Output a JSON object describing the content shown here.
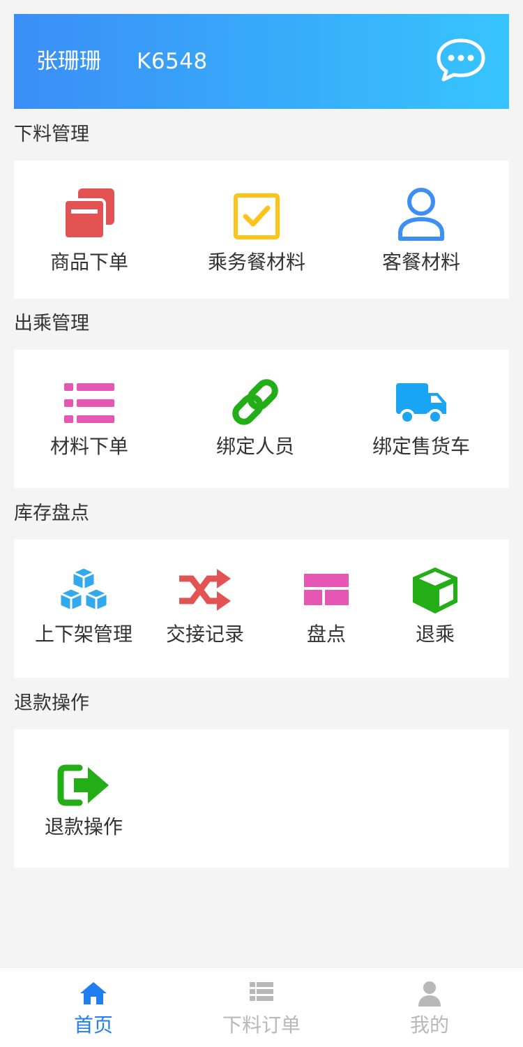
{
  "header": {
    "user_name": "张珊珊",
    "train_code": "K6548",
    "message_icon": "chat-bubble-icon"
  },
  "sections": [
    {
      "title": "下料管理",
      "items": [
        {
          "label": "商品下单",
          "icon": "cards-icon",
          "color": "#e45353"
        },
        {
          "label": "乘务餐材料",
          "icon": "checkbox-icon",
          "color": "#fcc419"
        },
        {
          "label": "客餐材料",
          "icon": "user-icon",
          "color": "#3b8ff6"
        }
      ]
    },
    {
      "title": "出乘管理",
      "items": [
        {
          "label": "材料下单",
          "icon": "list-icon",
          "color": "#e557b2"
        },
        {
          "label": "绑定人员",
          "icon": "link-icon",
          "color": "#23ad16"
        },
        {
          "label": "绑定售货车",
          "icon": "truck-icon",
          "color": "#1aa4f4"
        }
      ]
    },
    {
      "title": "库存盘点",
      "items": [
        {
          "label": "上下架管理",
          "icon": "cubes-icon",
          "color": "#32a9ec"
        },
        {
          "label": "交接记录",
          "icon": "shuffle-icon",
          "color": "#e45353"
        },
        {
          "label": "盘点",
          "icon": "table-icon",
          "color": "#e557b2"
        },
        {
          "label": "退乘",
          "icon": "cube-icon",
          "color": "#23ad16"
        }
      ]
    },
    {
      "title": "退款操作",
      "items": [
        {
          "label": "退款操作",
          "icon": "sign-out-icon",
          "color": "#23ad16"
        }
      ]
    }
  ],
  "tabbar": {
    "items": [
      {
        "label": "首页",
        "icon": "home-icon",
        "active": true
      },
      {
        "label": "下料订单",
        "icon": "list-icon",
        "active": false
      },
      {
        "label": "我的",
        "icon": "user-icon",
        "active": false
      }
    ],
    "active_color": "#1f7ff0",
    "inactive_color": "#b8b8b8"
  }
}
